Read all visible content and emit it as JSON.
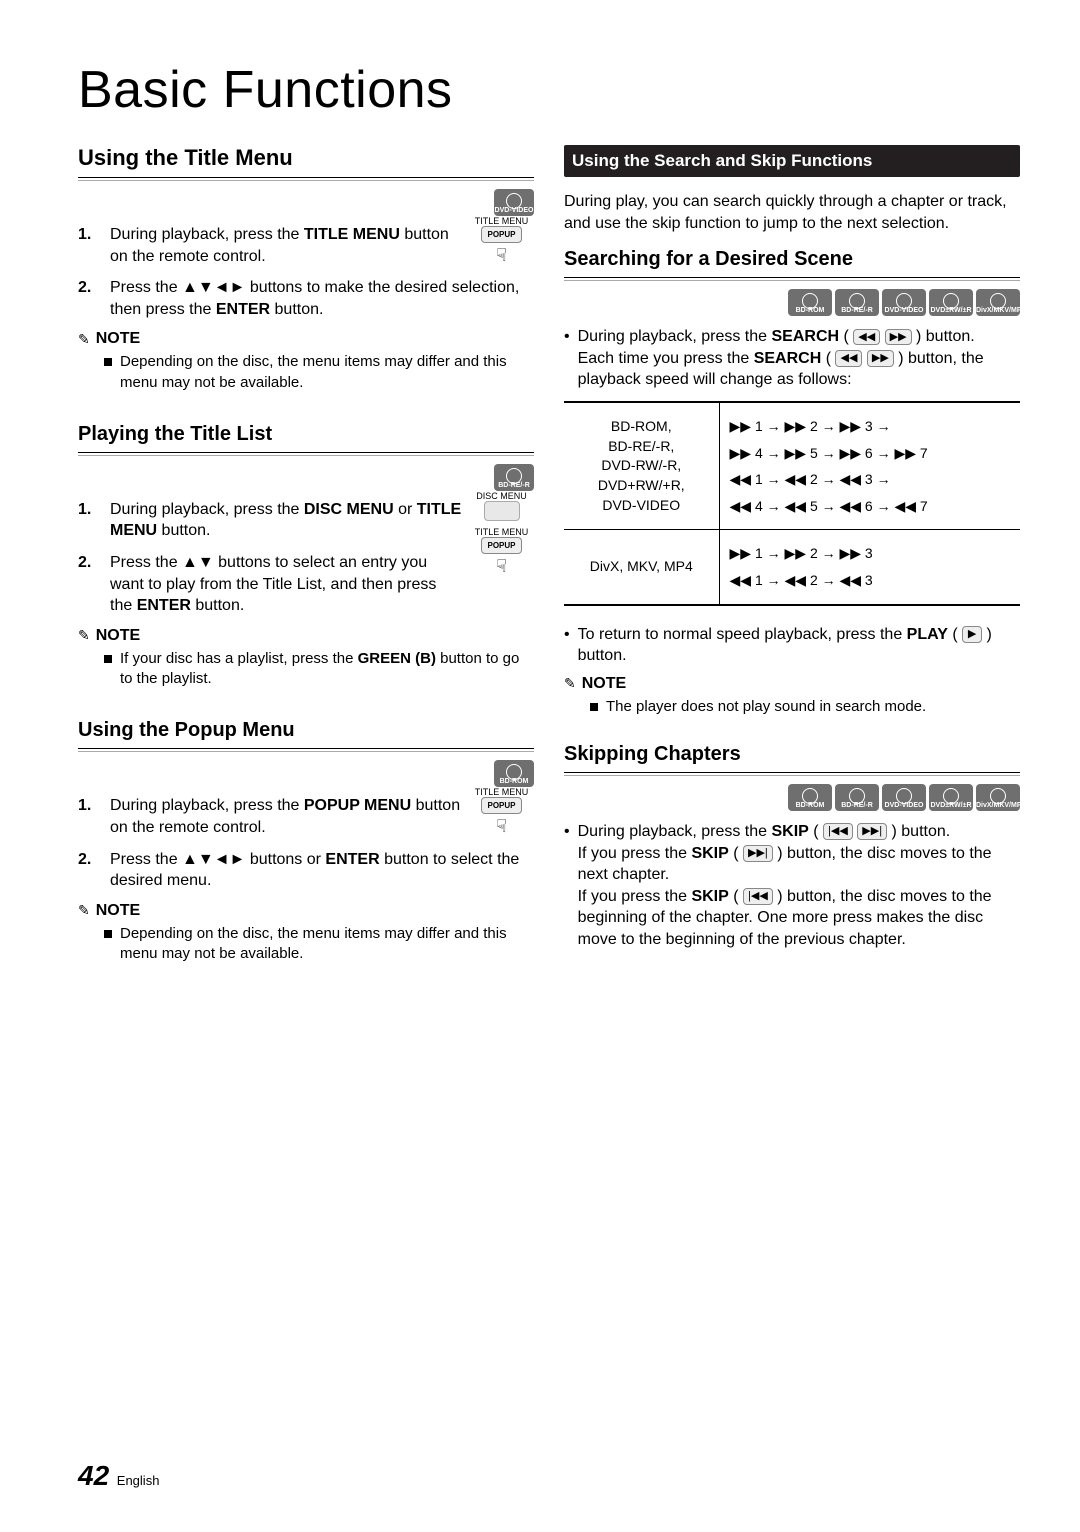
{
  "page": {
    "title": "Basic Functions",
    "footer_number": "42",
    "footer_lang": "English"
  },
  "left": {
    "s1": {
      "title": "Using the Title Menu",
      "badge": "DVD-VIDEO",
      "fig_l1": "TITLE MENU",
      "fig_l2": "POPUP",
      "step1_a": "During playback, press the ",
      "step1_b": "TITLE MENU",
      "step1_c": " button on the remote control.",
      "step2_a": "Press the ▲▼◄► buttons to make the desired selection, then press the ",
      "step2_b": "ENTER",
      "step2_c": " button.",
      "note_label": "NOTE",
      "note_body": "Depending on the disc, the menu items may differ and this menu may not be available."
    },
    "s2": {
      "title": "Playing the Title List",
      "badge": "BD-RE/-R",
      "fig_l1": "DISC MENU",
      "fig_l2": "TITLE MENU",
      "fig_l3": "POPUP",
      "step1_a": "During playback, press the ",
      "step1_b": "DISC MENU",
      "step1_c": " or ",
      "step1_d": "TITLE MENU",
      "step1_e": " button.",
      "step2_a": "Press the ▲▼ buttons to select an entry you want to play from the Title List, and then press the ",
      "step2_b": "ENTER",
      "step2_c": " button.",
      "note_label": "NOTE",
      "note_body_a": "If your disc has a playlist, press the ",
      "note_body_b": "GREEN (B)",
      "note_body_c": " button to go to the playlist."
    },
    "s3": {
      "title": "Using the Popup Menu",
      "badge": "BD-ROM",
      "fig_l1": "TITLE MENU",
      "fig_l2": "POPUP",
      "step1_a": "During playback, press the ",
      "step1_b": "POPUP MENU",
      "step1_c": " button on the remote control.",
      "step2_a": "Press the ▲▼◄► buttons or ",
      "step2_b": "ENTER",
      "step2_c": " button to select the desired menu.",
      "note_label": "NOTE",
      "note_body": "Depending on the disc, the menu items may differ and this menu may not be available."
    }
  },
  "right": {
    "black_heading": "Using the Search and Skip Functions",
    "intro": "During play, you can search quickly through a chapter or track, and use the skip function to jump to the next selection.",
    "s1": {
      "title": "Searching for a Desired Scene",
      "badges": [
        "BD-ROM",
        "BD-RE/-R",
        "DVD-VIDEO",
        "DVD±RW/±R",
        "DivX/MKV/MP4"
      ],
      "b1_a": "During playback, press the ",
      "b1_b": "SEARCH",
      "b1_c": " ( ",
      "b1_d": " ) button.",
      "b1_line2_a": "Each time you press the ",
      "b1_line2_b": "SEARCH",
      "b1_line2_c": " ( ",
      "b1_line2_d": " ) button, the playback speed will change as follows:",
      "table": {
        "r1_left": "BD-ROM,\nBD-RE/-R,\nDVD-RW/-R,\nDVD+RW/+R,\nDVD-VIDEO",
        "r1_right": "▶▶ 1 → ▶▶ 2 → ▶▶ 3 →\n▶▶ 4 → ▶▶ 5 → ▶▶ 6 → ▶▶ 7\n◀◀ 1 → ◀◀ 2 → ◀◀ 3 →\n◀◀ 4 → ◀◀ 5 → ◀◀ 6 → ◀◀ 7",
        "r2_left": "DivX, MKV, MP4",
        "r2_right": "▶▶ 1 → ▶▶ 2 → ▶▶ 3\n◀◀ 1 → ◀◀ 2 → ◀◀ 3"
      },
      "b2_a": "To return to normal speed playback, press the ",
      "b2_b": "PLAY",
      "b2_c": " ( ",
      "b2_d": " ) button.",
      "note_label": "NOTE",
      "note_body": "The player does not play sound in search mode."
    },
    "s2": {
      "title": "Skipping Chapters",
      "badges": [
        "BD-ROM",
        "BD-RE/-R",
        "DVD-VIDEO",
        "DVD±RW/±R",
        "DivX/MKV/MP4"
      ],
      "b1_a": "During playback, press the ",
      "b1_b": "SKIP",
      "b1_c": " ( ",
      "b1_d": " ) button.",
      "p2_a": "If you press the ",
      "p2_b": "SKIP",
      "p2_c": " ( ",
      "p2_d": " ) button, the disc moves to the next chapter.",
      "p3_a": "If you press the ",
      "p3_b": "SKIP",
      "p3_c": " ( ",
      "p3_d": " ) button, the disc moves to the beginning of the chapter. One more press makes the disc move to the beginning of the previous chapter."
    }
  }
}
